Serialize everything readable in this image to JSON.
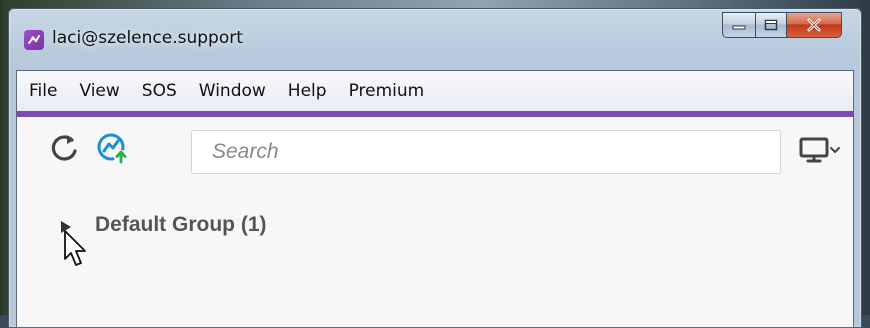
{
  "window": {
    "title": "laci@szelence.support",
    "app_icon": "app-logo-icon"
  },
  "caption_buttons": [
    "minimize-icon",
    "maximize-icon",
    "close-icon"
  ],
  "menubar": {
    "items": [
      "File",
      "View",
      "SOS",
      "Window",
      "Help",
      "Premium"
    ]
  },
  "toolbar": {
    "refresh_icon": "refresh-icon",
    "connect_icon": "remote-connect-icon",
    "search_placeholder": "Search",
    "monitor_icon": "monitor-icon"
  },
  "groups": [
    {
      "label": "Default Group (1)",
      "expanded": false
    }
  ],
  "colors": {
    "accent": "#7b4bb3",
    "connect_blue": "#1a8fd6",
    "connect_green": "#2bb24c",
    "close_red": "#c2371a"
  }
}
